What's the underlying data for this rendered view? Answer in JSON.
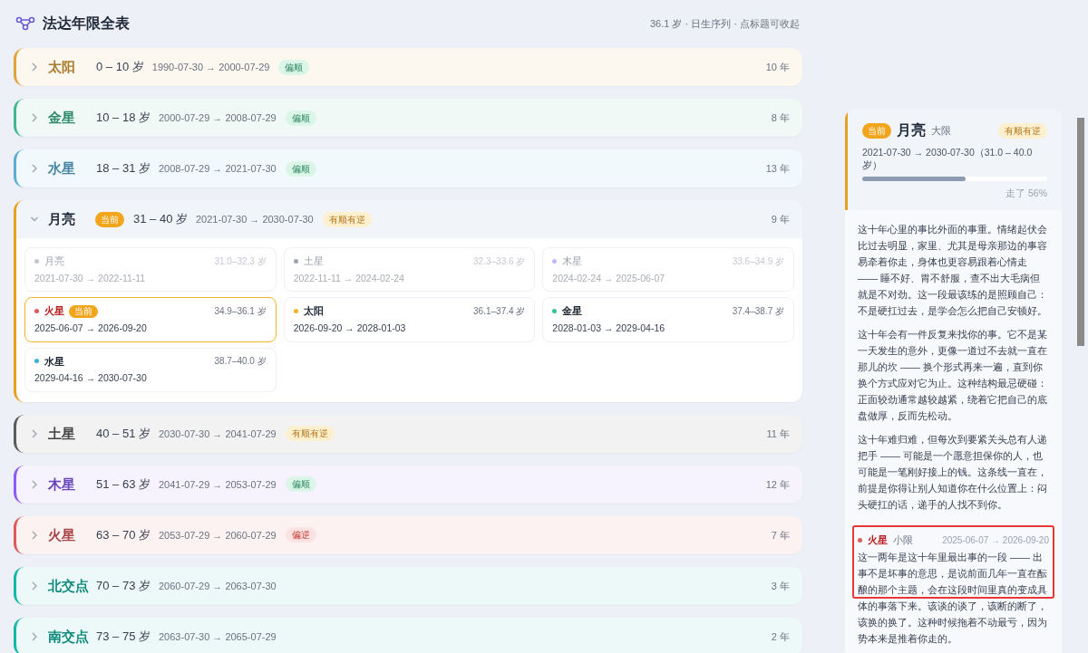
{
  "header": {
    "title": "法达年限全表",
    "note": "36.1 岁 · 日生序列 · 点标题可收起"
  },
  "periods": [
    {
      "planet": "太阳",
      "color": "#e0a43a",
      "age": "0 – 10 岁",
      "dates": "1990-07-30 → 2000-07-29",
      "tag": {
        "text": "偏顺",
        "kind": "good"
      },
      "years": "10 年",
      "expanded": false
    },
    {
      "planet": "金星",
      "color": "#3fb88f",
      "age": "10 – 18 岁",
      "dates": "2000-07-29 → 2008-07-29",
      "tag": {
        "text": "偏顺",
        "kind": "good"
      },
      "years": "8 年",
      "expanded": false
    },
    {
      "planet": "水星",
      "color": "#5aaed6",
      "age": "18 – 31 岁",
      "dates": "2008-07-29 → 2021-07-30",
      "tag": {
        "text": "偏顺",
        "kind": "good"
      },
      "years": "13 年",
      "expanded": false
    },
    {
      "planet": "月亮",
      "color": "#e8a020",
      "badge": "当前",
      "age": "31 – 40 岁",
      "dates": "2021-07-30 → 2030-07-30",
      "tag": {
        "text": "有顺有逆",
        "kind": "mixed"
      },
      "years": "9 年",
      "expanded": true,
      "subperiods": [
        {
          "planet": "月亮",
          "color": "#c0c4cc",
          "ages": "31.0–32.3 岁",
          "dates": "2021-07-30 → 2022-11-11",
          "past": true,
          "selected": false
        },
        {
          "planet": "土星",
          "color": "#9ca3af",
          "ages": "32.3–33.6 岁",
          "dates": "2022-11-11 → 2024-02-24",
          "past": true,
          "selected": false
        },
        {
          "planet": "木星",
          "color": "#c4b5fd",
          "ages": "33.6–34.9 岁",
          "dates": "2024-02-24 → 2025-06-07",
          "past": true,
          "selected": false
        },
        {
          "planet": "火星",
          "color": "#e05a5a",
          "badge": "当前",
          "ages": "34.9–36.1 岁",
          "dates": "2025-06-07 → 2026-09-20",
          "past": false,
          "selected": true
        },
        {
          "planet": "太阳",
          "color": "#f0b429",
          "ages": "36.1–37.4 岁",
          "dates": "2026-09-20 → 2028-01-03",
          "past": false,
          "selected": false
        },
        {
          "planet": "金星",
          "color": "#34c38f",
          "ages": "37.4–38.7 岁",
          "dates": "2028-01-03 → 2029-04-16",
          "past": false,
          "selected": false
        },
        {
          "planet": "水星",
          "color": "#38b2d8",
          "ages": "38.7–40.0 岁",
          "dates": "2029-04-16 → 2030-07-30",
          "past": false,
          "selected": false
        }
      ]
    },
    {
      "planet": "土星",
      "color": "#5b5b5b",
      "age": "40 – 51 岁",
      "dates": "2030-07-30 → 2041-07-29",
      "tag": {
        "text": "有顺有逆",
        "kind": "mixed"
      },
      "years": "11 年",
      "expanded": false
    },
    {
      "planet": "木星",
      "color": "#8b5cf6",
      "age": "51 – 63 岁",
      "dates": "2041-07-29 → 2053-07-29",
      "tag": {
        "text": "偏顺",
        "kind": "good"
      },
      "years": "12 年",
      "expanded": false
    },
    {
      "planet": "火星",
      "color": "#e05a5a",
      "age": "63 – 70 岁",
      "dates": "2053-07-29 → 2060-07-29",
      "tag": {
        "text": "偏逆",
        "kind": "bad"
      },
      "years": "7 年",
      "expanded": false
    },
    {
      "planet": "北交点",
      "color": "#14b8a6",
      "age": "70 – 73 岁",
      "dates": "2060-07-29 → 2063-07-30",
      "years": "3 年",
      "expanded": false
    },
    {
      "planet": "南交点",
      "color": "#14b8a6",
      "age": "73 – 75 岁",
      "dates": "2063-07-30 → 2065-07-29",
      "years": "2 年",
      "expanded": false
    }
  ],
  "detail": {
    "badge": "当前",
    "planet": "月亮",
    "color": "#e8a020",
    "level_label": "大限",
    "tag": {
      "text": "有顺有逆",
      "kind": "mixed"
    },
    "range": "2021-07-30 → 2030-07-30（31.0 – 40.0 岁）",
    "level": 0.56,
    "progress_text": "走了 56%",
    "paragraphs": [
      "这十年心里的事比外面的事重。情绪起伏会比过去明显，家里、尤其是母亲那边的事容易牵着你走，身体也更容易跟着心情走 —— 睡不好、胃不舒服，查不出大毛病但就是不对劲。这一段最该练的是照顾自己：不是硬扛过去，是学会怎么把自己安顿好。",
      "这十年会有一件反复来找你的事。它不是某一天发生的意外，更像一道过不去就一直在那儿的坎 —— 换个形式再来一遍，直到你换个方式应对它为止。这种结构最忌硬碰：正面较劲通常越较越紧，绕着它把自己的底盘做厚，反而先松动。",
      "这十年难归难，但每次到要紧关头总有人递把手 —— 可能是一个愿意担保你的人，也可能是一笔刚好接上的钱。这条线一直在，前提是你得让别人知道你在什么位置上：闷头硬扛的话，递手的人找不到你。"
    ],
    "minor": {
      "planet": "火星",
      "color": "#e05a5a",
      "label": "小限",
      "dates": "2025-06-07 → 2026-09-20",
      "highlighted": true,
      "text": "这一两年是这十年里最出事的一段 —— 出事不是坏事的意思，是说前面几年一直在酝酿的那个主题，会在这段时间里真的变成具体的事落下来。该谈的谈了，该断的断了，该换的换了。这种时候拖着不动最亏，因为势本来是推着你走的。"
    }
  }
}
